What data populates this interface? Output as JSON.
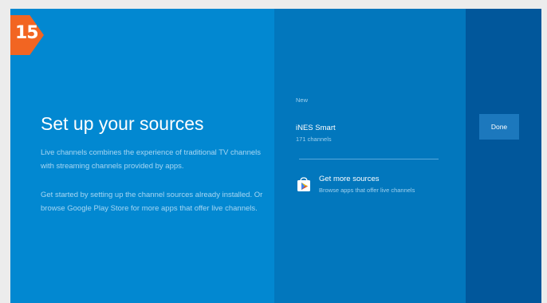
{
  "badge": {
    "number": "15"
  },
  "setup": {
    "title": "Set up your sources",
    "description_1": "Live channels combines the experience of traditional TV channels with streaming channels provided by apps.",
    "description_2": "Get started by setting up the channel sources already installed. Or browse Google Play Store for more apps that offer live channels."
  },
  "sources": {
    "section_label": "New",
    "items": [
      {
        "name": "iNES Smart",
        "count": "171 channels"
      }
    ],
    "get_more": {
      "title": "Get more sources",
      "subtitle": "Browse apps that offer live channels",
      "icon": "play-store-icon"
    }
  },
  "actions": {
    "done_label": "Done"
  },
  "colors": {
    "left_panel": "#0288d1",
    "middle_panel": "#0277bd",
    "right_panel": "#01579b",
    "badge": "#f26522",
    "button": "#1c78bd"
  }
}
